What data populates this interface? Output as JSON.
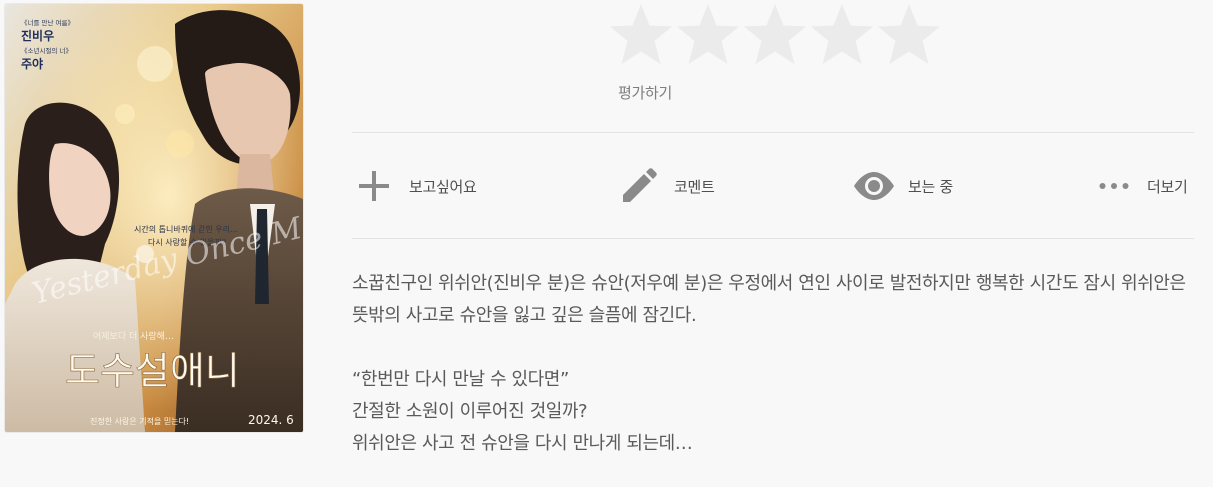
{
  "poster": {
    "cast_top_1_role": "《너를 만난 여름》",
    "cast_top_1_name": "진비우",
    "cast_top_2_role": "《소년시절의 너》",
    "cast_top_2_name": "주야",
    "tagline_line1": "시간의 톱니바퀴에 갇힌 우리…",
    "tagline_line2": "다시 사랑할 수 있을까?",
    "script_title": "Yesterday Once More",
    "subtitle": "어제보다 더 사랑해…",
    "title": "도수설애니",
    "bottom_caption": "진정한 사랑은 기적을 믿는다!",
    "release": "2024. 6"
  },
  "rating": {
    "stars": 5,
    "value": 0,
    "label": "평가하기",
    "star_color": "#ebebeb"
  },
  "actions": [
    {
      "label": "보고싶어요",
      "icon": "plus-icon"
    },
    {
      "label": "코멘트",
      "icon": "pencil-icon"
    },
    {
      "label": "보는 중",
      "icon": "eye-icon"
    },
    {
      "label": "더보기",
      "icon": "more-dots-icon"
    }
  ],
  "description": {
    "paragraph1": "소꿉친구인 위쉬안(진비우 분)은 슈안(저우예 분)은 우정에서 연인 사이로 발전하지만 행복한 시간도 잠시 위쉬안은 뜻밖의 사고로 슈안을 잃고 깊은 슬픔에 잠긴다.",
    "line1": "“한번만 다시 만날 수 있다면”",
    "line2": "간절한 소원이 이루어진 것일까?",
    "line3": "위쉬안은 사고 전 슈안을 다시 만나게 되는데…"
  },
  "colors": {
    "background": "#f8f8f8",
    "icon": "#8a8a8a",
    "divider": "#e3e3e3"
  }
}
